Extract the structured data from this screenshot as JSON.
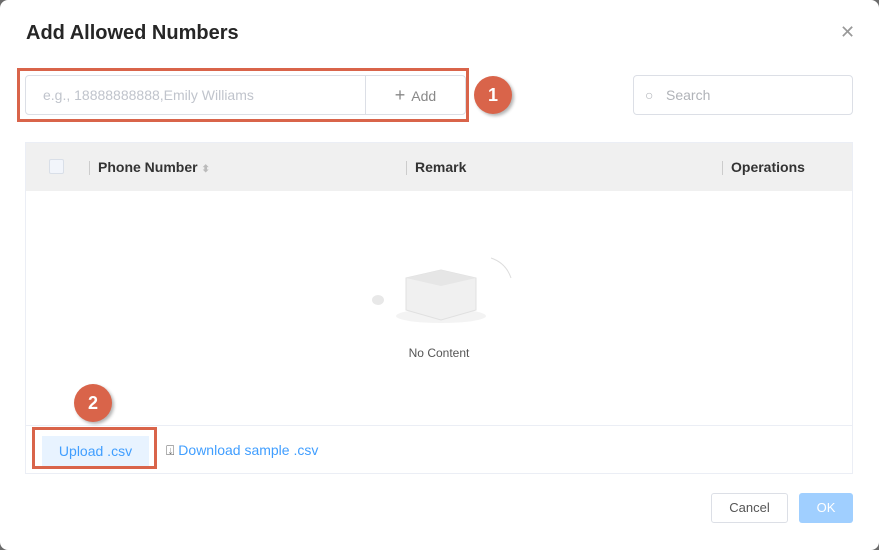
{
  "dialog": {
    "title": "Add Allowed Numbers",
    "close_icon": "close-icon"
  },
  "add_input": {
    "placeholder": "e.g., 18888888888,Emily Williams",
    "add_label": "Add",
    "plus": "+"
  },
  "search": {
    "placeholder": "Search"
  },
  "table": {
    "columns": [
      "Phone Number",
      "Remark",
      "Operations"
    ],
    "empty_text": "No Content"
  },
  "footer": {
    "upload_label": "Upload .csv",
    "download_label": "Download sample .csv"
  },
  "actions": {
    "cancel": "Cancel",
    "ok": "OK"
  },
  "annotations": [
    "1",
    "2"
  ],
  "colors": {
    "annotation": "#d9644a",
    "link": "#409eff",
    "ok_disabled": "#a0cfff"
  }
}
